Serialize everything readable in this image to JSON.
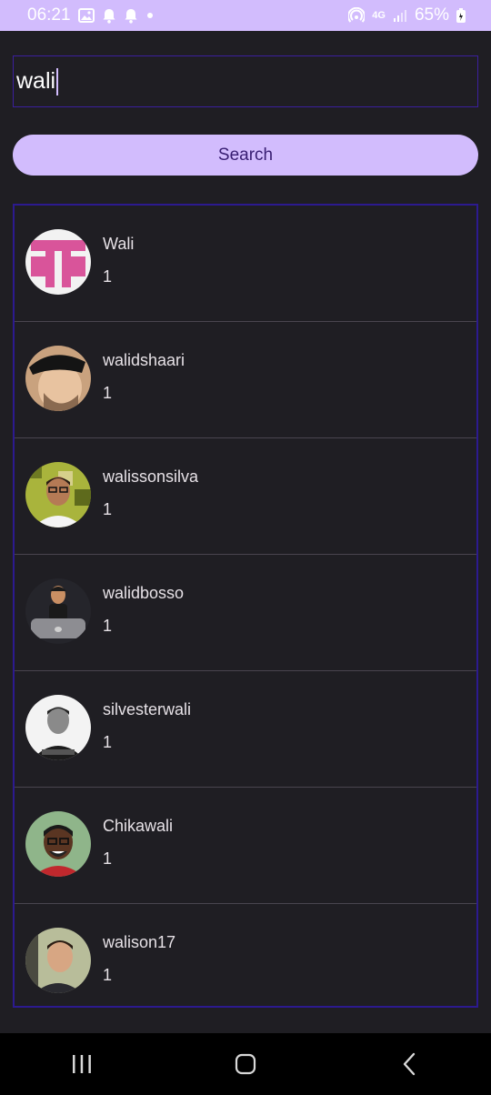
{
  "status_bar": {
    "time": "06:21",
    "network": "4G",
    "battery": "65%",
    "left_icons": [
      "image-icon",
      "bell-icon",
      "bell-icon",
      "dot-icon"
    ],
    "right_icons": [
      "hotspot-icon",
      "signal-icon",
      "battery-icon"
    ]
  },
  "search": {
    "value": "wali"
  },
  "search_button": {
    "label": "Search"
  },
  "results": [
    {
      "name": "Wali",
      "count": "1",
      "avatar": "pink-cross-avatar"
    },
    {
      "name": "walidshaari",
      "count": "1",
      "avatar": "cap-man-avatar"
    },
    {
      "name": "walissonsilva",
      "count": "1",
      "avatar": "glasses-man-avatar"
    },
    {
      "name": "walidbosso",
      "count": "1",
      "avatar": "cartoon-laptop-avatar"
    },
    {
      "name": "silvesterwali",
      "count": "1",
      "avatar": "bw-man-avatar"
    },
    {
      "name": "Chikawali",
      "count": "1",
      "avatar": "smiling-man-avatar"
    },
    {
      "name": "walison17",
      "count": "1",
      "avatar": "young-man-avatar"
    }
  ],
  "nav_bar": {
    "buttons": [
      "recent-apps-icon",
      "home-icon",
      "back-icon"
    ]
  },
  "colors": {
    "background": "#1f1e23",
    "accent": "#d2bcfd",
    "button_text": "#381e72",
    "border": "#2c1a8f"
  }
}
